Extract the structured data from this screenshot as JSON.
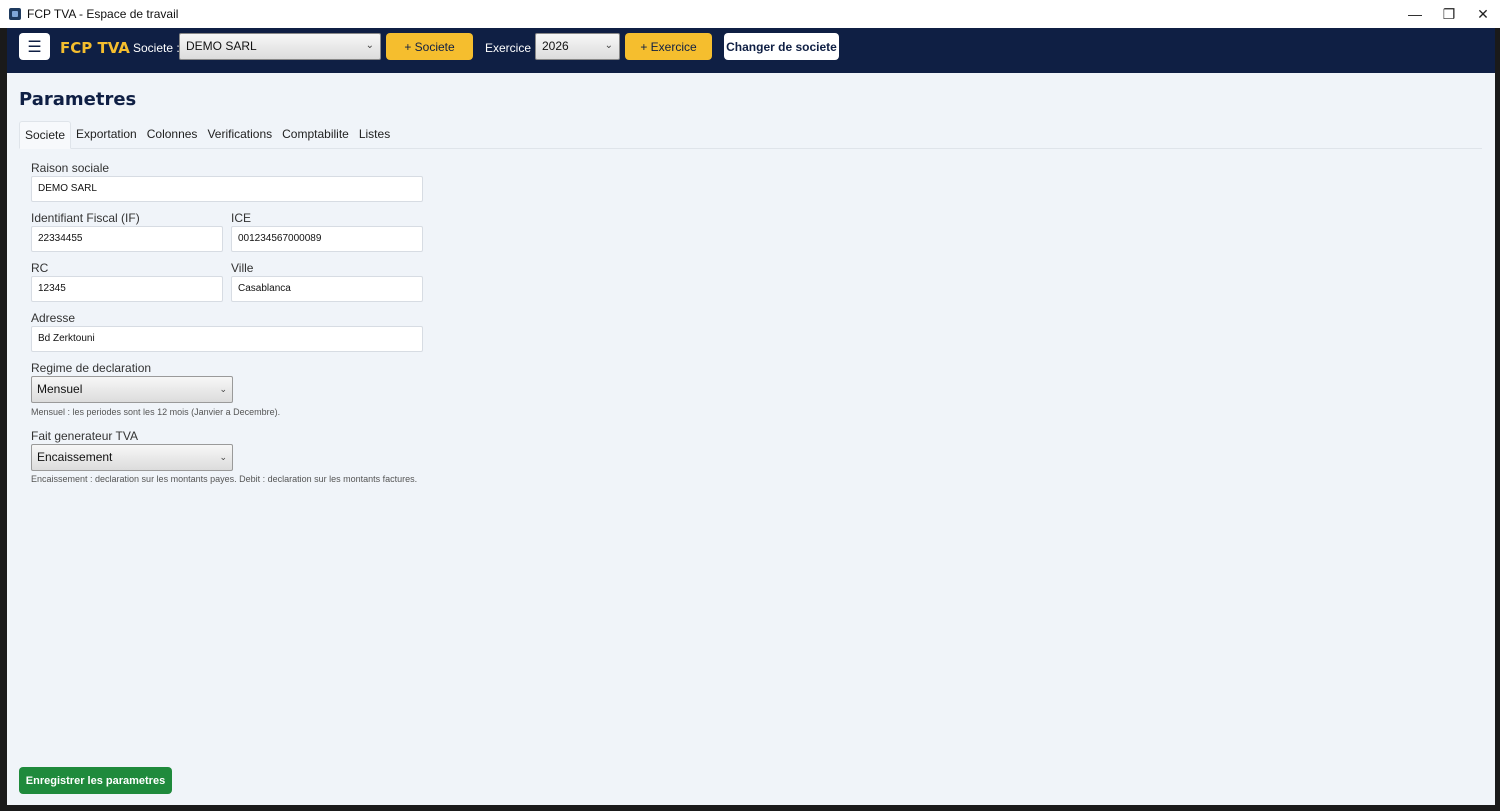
{
  "window": {
    "title": "FCP TVA - Espace de travail",
    "minimize": "—",
    "restore": "❐",
    "close": "✕"
  },
  "header": {
    "menu_glyph": "☰",
    "brand": "FCP TVA",
    "societe_label": "Societe :",
    "societe_value": "DEMO SARL",
    "add_societe": "+ Societe",
    "exercice_label": "Exercice :",
    "exercice_value": "2026",
    "add_exercice": "+ Exercice",
    "change_societe": "Changer de societe",
    "chevron": "⌄"
  },
  "page": {
    "title": "Parametres",
    "tabs": [
      {
        "label": "Societe",
        "active": true
      },
      {
        "label": "Exportation"
      },
      {
        "label": "Colonnes"
      },
      {
        "label": "Verifications"
      },
      {
        "label": "Comptabilite"
      },
      {
        "label": "Listes"
      }
    ]
  },
  "form": {
    "raison_sociale_label": "Raison sociale",
    "raison_sociale": "DEMO SARL",
    "if_label": "Identifiant Fiscal (IF)",
    "if_value": "22334455",
    "ice_label": "ICE",
    "ice_value": "001234567000089",
    "rc_label": "RC",
    "rc_value": "12345",
    "ville_label": "Ville",
    "ville_value": "Casablanca",
    "adresse_label": "Adresse",
    "adresse_value": "Bd Zerktouni",
    "regime_label": "Regime de declaration",
    "regime_value": "Mensuel",
    "regime_help": "Mensuel : les periodes sont les 12 mois (Janvier a Decembre).",
    "fait_label": "Fait generateur TVA",
    "fait_value": "Encaissement",
    "fait_help": "Encaissement : declaration sur les montants payes. Debit : declaration sur les montants factures."
  },
  "actions": {
    "save": "Enregistrer les parametres"
  },
  "colors": {
    "header_bg": "#0f1f44",
    "accent_yellow": "#f5be2e",
    "save_green": "#1f8a3c",
    "page_bg": "#f0f4f9"
  }
}
